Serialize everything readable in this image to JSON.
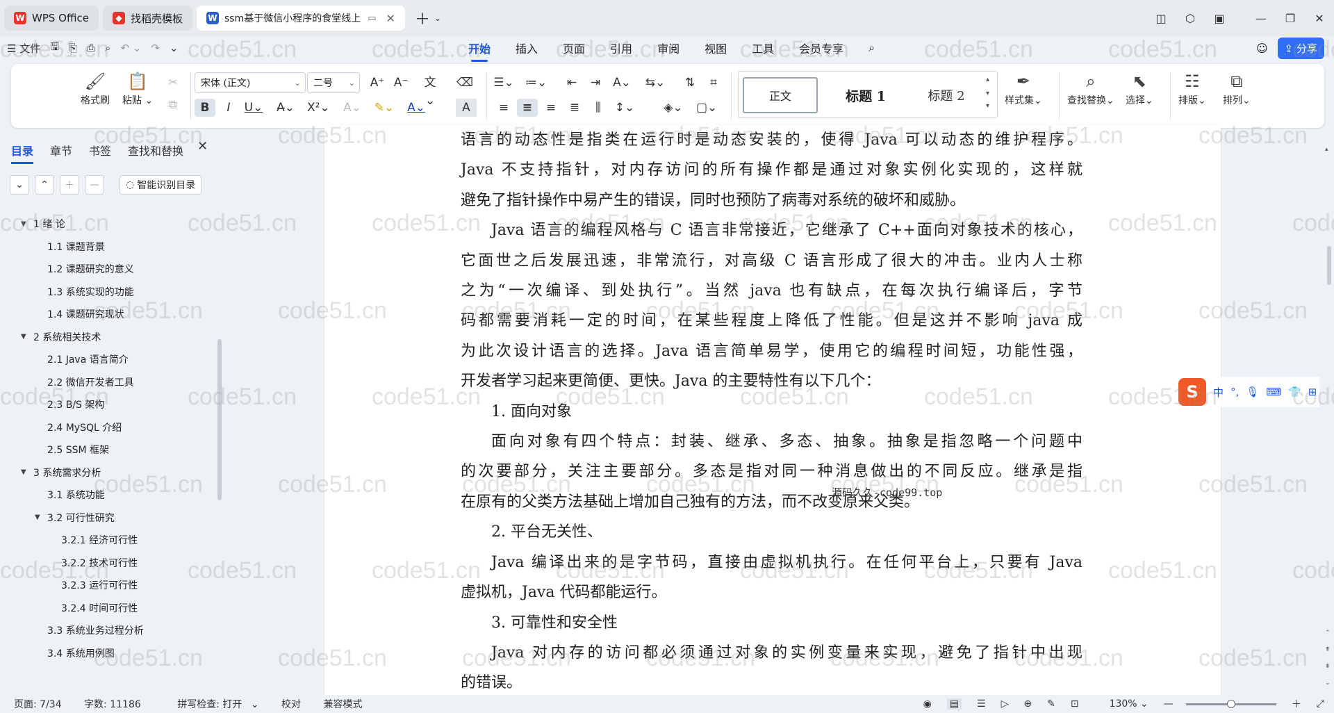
{
  "tabs": [
    {
      "label": "WPS Office",
      "icon": "wps-logo-icon",
      "color": "#e8332a"
    },
    {
      "label": "找稻壳模板",
      "icon": "docer-icon",
      "color": "#e8332a"
    },
    {
      "label": "ssm基于微信小程序的食堂线上",
      "icon": "word-doc-icon",
      "color": "#2b5dcd"
    }
  ],
  "menu_left": {
    "file": "文件"
  },
  "menus": [
    "开始",
    "插入",
    "页面",
    "引用",
    "审阅",
    "视图",
    "工具",
    "会员专享"
  ],
  "share_label": "分享",
  "ribbon": {
    "format_painter": "格式刷",
    "paste": "粘贴",
    "font_name": "宋体 (正文)",
    "font_size": "二号",
    "styles": [
      "正文",
      "标题 1",
      "标题 2"
    ],
    "style_set": "样式集",
    "find_replace": "查找替换",
    "select": "选择",
    "layout": "排版",
    "arrange": "排列"
  },
  "nav": {
    "tabs": [
      "目录",
      "章节",
      "书签",
      "查找和替换"
    ],
    "smart_toc": "智能识别目录",
    "toc": [
      {
        "label": "1 绪  论",
        "level": 1,
        "expanded": true
      },
      {
        "label": "1.1  课题背景",
        "level": 2
      },
      {
        "label": "1.2  课题研究的意义",
        "level": 2
      },
      {
        "label": "1.3  系统实现的功能",
        "level": 2
      },
      {
        "label": "1.4  课题研究现状",
        "level": 2
      },
      {
        "label": "2 系统相关技术",
        "level": 1,
        "expanded": true
      },
      {
        "label": "2.1 Java 语言简介",
        "level": 2
      },
      {
        "label": "2.2 微信开发者工具",
        "level": 2
      },
      {
        "label": "2.3 B/S 架构",
        "level": 2
      },
      {
        "label": "2.4 MySQL  介绍",
        "level": 2
      },
      {
        "label": "2.5 SSM 框架",
        "level": 2
      },
      {
        "label": "3 系统需求分析",
        "level": 1,
        "expanded": true
      },
      {
        "label": "3.1 系统功能",
        "level": 2
      },
      {
        "label": "3.2 可行性研究",
        "level": 2,
        "expanded": true
      },
      {
        "label": "3.2.1  经济可行性",
        "level": 3
      },
      {
        "label": "3.2.2  技术可行性",
        "level": 3
      },
      {
        "label": "3.2.3  运行可行性",
        "level": 3
      },
      {
        "label": "3.2.4  时间可行性",
        "level": 3
      },
      {
        "label": "3.3 系统业务过程分析",
        "level": 2
      },
      {
        "label": "3.4 系统用例图",
        "level": 2
      }
    ]
  },
  "doc": {
    "lines": [
      {
        "text": "语言的动态性是指类在运行时是动态安装的，使得 Java 可以动态的维护程序。",
        "indent": false,
        "justify": true
      },
      {
        "text": "Java 不支持指针，对内存访问的所有操作都是通过对象实例化实现的，这样就",
        "indent": false,
        "justify": true
      },
      {
        "text": "避免了指针操作中易产生的错误，同时也预防了病毒对系统的破坏和威胁。",
        "indent": false,
        "justify": false
      },
      {
        "text": "Java 语言的编程风格与 C 语言非常接近，它继承了 C++面向对象技术的核心，",
        "indent": true,
        "justify": true
      },
      {
        "text": "它面世之后发展迅速，非常流行，对高级 C 语言形成了很大的冲击。业内人士称",
        "indent": false,
        "justify": true
      },
      {
        "text": "之为“一次编译、到处执行”。当然 java 也有缺点，在每次执行编译后，字节",
        "indent": false,
        "justify": true
      },
      {
        "text": "码都需要消耗一定的时间，在某些程度上降低了性能。但是这并不影响 java 成",
        "indent": false,
        "justify": true
      },
      {
        "text": "为此次设计语言的选择。Java 语言简单易学，使用它的编程时间短，功能性强，",
        "indent": false,
        "justify": true
      },
      {
        "text": "开发者学习起来更简便、更快。Java 的主要特性有以下几个：",
        "indent": false,
        "justify": false
      },
      {
        "text": "1. 面向对象",
        "indent": true,
        "justify": false
      },
      {
        "text": "面向对象有四个特点：封装、继承、多态、抽象。抽象是指忽略一个问题中",
        "indent": true,
        "justify": true
      },
      {
        "text": "的次要部分，关注主要部分。多态是指对同一种消息做出的不同反应。继承是指",
        "indent": false,
        "justify": true
      },
      {
        "text": "在原有的父类方法基础上增加自己独有的方法，而不改变原来父类。",
        "indent": false,
        "justify": false
      },
      {
        "text": "2. 平台无关性、",
        "indent": true,
        "justify": false
      },
      {
        "text": "Java 编译出来的是字节码，直接由虚拟机执行。在任何平台上，只要有 Java",
        "indent": true,
        "justify": true
      },
      {
        "text": "虚拟机，Java 代码都能运行。",
        "indent": false,
        "justify": false
      },
      {
        "text": "3. 可靠性和安全性",
        "indent": true,
        "justify": false
      },
      {
        "text": "Java 对内存的访问都必须通过对象的实例变量来实现，避免了指针中出现",
        "indent": true,
        "justify": true
      },
      {
        "text": "的错误。",
        "indent": false,
        "justify": false
      }
    ],
    "floating_note": "源码久久-code99.top"
  },
  "ime": {
    "mode": "中"
  },
  "watermark": "code51.cn",
  "status": {
    "page": "页面: 7/34",
    "words": "字数: 11186",
    "spell": "拼写检查: 打开",
    "proof": "校对",
    "compat": "兼容模式",
    "zoom": "130%",
    "zoom_level": 0.5
  }
}
